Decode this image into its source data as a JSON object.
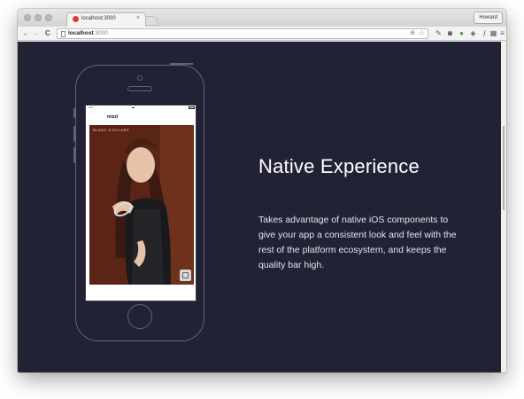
{
  "browser": {
    "tab": {
      "title": "localhost:3000",
      "close_glyph": "×"
    },
    "profile_name": "Howard",
    "nav": {
      "back": "←",
      "forward": "→",
      "reload": "C"
    },
    "url": {
      "host": "localhost",
      "port": ":3000"
    },
    "extensions": [
      "wrench-icon",
      "pocket-icon",
      "evernote-icon",
      "shield-icon",
      "fx-icon",
      "qr-icon",
      "menu-icon"
    ]
  },
  "phone_screen": {
    "navbar_title": "mizzl",
    "photo_caption": "BLANC & ECLARE"
  },
  "content": {
    "heading": "Native Experience",
    "description": "Takes advantage of native iOS components to give your app a consistent look and feel with the rest of the platform ecosystem, and keeps the quality bar high."
  },
  "colors": {
    "page_background": "#222235",
    "phone_outline": "#62627c",
    "heading_text": "#ffffff"
  }
}
